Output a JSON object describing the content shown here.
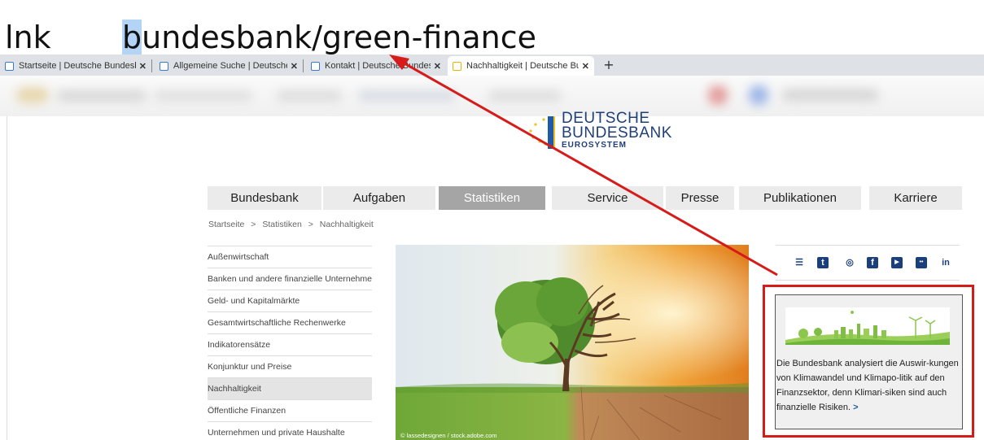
{
  "annotation": {
    "lnk": "lnk",
    "url_highlight": "b",
    "url_rest": "undesbank/green-finance"
  },
  "tabs": [
    {
      "title": "Startseite | Deutsche Bundesbank",
      "close": "✕"
    },
    {
      "title": "Allgemeine Suche | Deutsche Bun",
      "close": "✕"
    },
    {
      "title": "Kontakt | Deutsche Bundesbank",
      "close": "✕"
    },
    {
      "title": "Nachhaltigkeit | Deutsche Bunde",
      "close": "✕"
    }
  ],
  "newtab": "+",
  "logo": {
    "line1": "DEUTSCHE",
    "line2": "BUNDESBANK",
    "line3": "EUROSYSTEM"
  },
  "nav": [
    {
      "label": "Bundesbank"
    },
    {
      "label": "Aufgaben"
    },
    {
      "label": "Statistiken"
    },
    {
      "label": "Service"
    },
    {
      "label": "Presse"
    },
    {
      "label": "Publikationen"
    },
    {
      "label": "Karriere"
    }
  ],
  "breadcrumb": {
    "items": [
      "Startseite",
      "Statistiken",
      "Nachhaltigkeit"
    ],
    "separator": ">"
  },
  "sidemenu": [
    {
      "label": "Außenwirtschaft"
    },
    {
      "label": "Banken und andere finanzielle Unternehmen"
    },
    {
      "label": "Geld- und Kapitalmärkte"
    },
    {
      "label": "Gesamtwirtschaftliche Rechenwerke"
    },
    {
      "label": "Indikatorensätze"
    },
    {
      "label": "Konjunktur und Preise"
    },
    {
      "label": "Nachhaltigkeit"
    },
    {
      "label": "Öffentliche Finanzen"
    },
    {
      "label": "Unternehmen und private Haushalte"
    }
  ],
  "hero": {
    "credit": "© lassedesignen / stock.adobe.com"
  },
  "social": [
    {
      "icon": "list-icon",
      "glyph": "☰"
    },
    {
      "icon": "twitter-icon",
      "glyph": "t"
    },
    {
      "icon": "instagram-icon",
      "glyph": "◎"
    },
    {
      "icon": "facebook-icon",
      "glyph": "f"
    },
    {
      "icon": "youtube-icon",
      "glyph": "▶"
    },
    {
      "icon": "flickr-icon",
      "glyph": "••"
    },
    {
      "icon": "linkedin-icon",
      "glyph": "in"
    }
  ],
  "teaser": {
    "text": "Die Bundesbank analysiert die Auswir-kungen von Klimawandel und Klimapo-litik auf den Finanzsektor, denn Klimari-siken sind auch finanzielle Risiken.",
    "more": ">"
  },
  "colors": {
    "annotation_red": "#d61b1b",
    "brand_blue": "#1f5aa6",
    "nav_active": "#a5a5a5"
  }
}
